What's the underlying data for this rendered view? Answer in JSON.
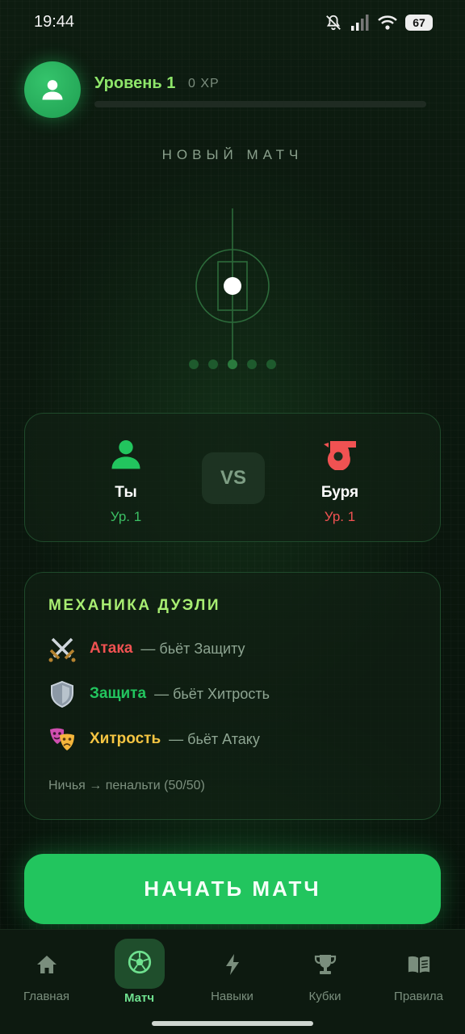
{
  "status_bar": {
    "time": "19:44",
    "battery": "67"
  },
  "profile": {
    "level": "Уровень 1",
    "xp": "0 XP",
    "xp_progress": 0
  },
  "screen_title": "НОВЫЙ МАТЧ",
  "carousel": {
    "count": 5,
    "active_index": 2
  },
  "matchup": {
    "player": {
      "name": "Ты",
      "level": "Ур. 1",
      "color": "#22c55e"
    },
    "vs": "VS",
    "opponent": {
      "name": "Буря",
      "level": "Ур. 1",
      "color": "#f05252"
    }
  },
  "mechanics": {
    "title": "МЕХАНИКА ДУЭЛИ",
    "items": [
      {
        "icon": "crossed-swords-icon",
        "name": "Атака",
        "desc": "— бьёт Защиту",
        "color": "#f05252"
      },
      {
        "icon": "shield-icon",
        "name": "Защита",
        "desc": "— бьёт Хитрость",
        "color": "#22c55e"
      },
      {
        "icon": "theater-masks-icon",
        "name": "Хитрость",
        "desc": "— бьёт Атаку",
        "color": "#f5c542"
      }
    ],
    "note": "Ничья → пенальти (50/50)"
  },
  "start_button": "НАЧАТЬ МАТЧ",
  "nav": [
    {
      "label": "Главная",
      "icon": "home-icon"
    },
    {
      "label": "Матч",
      "icon": "soccer-ball-icon",
      "active": true
    },
    {
      "label": "Навыки",
      "icon": "lightning-icon"
    },
    {
      "label": "Кубки",
      "icon": "trophy-icon"
    },
    {
      "label": "Правила",
      "icon": "book-icon"
    }
  ]
}
